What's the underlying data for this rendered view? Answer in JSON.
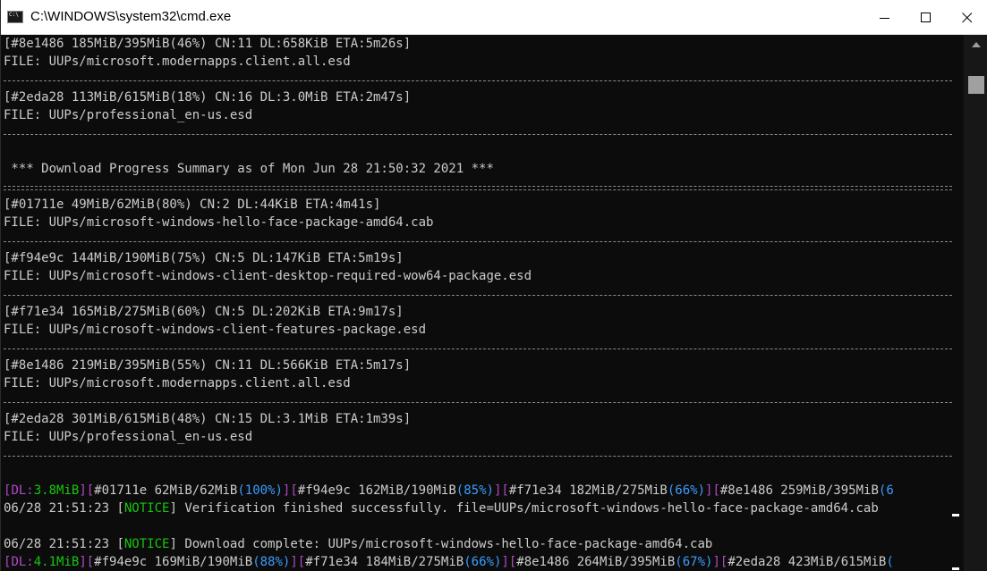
{
  "window": {
    "title": "C:\\WINDOWS\\system32\\cmd.exe",
    "icon_label": "C:\\",
    "icon": "cmd-app-icon",
    "controls": [
      "minimize-icon",
      "maximize-icon",
      "close-icon"
    ]
  },
  "console": {
    "lines": [
      "[#8e1486 185MiB/395MiB(46%) CN:11 DL:658KiB ETA:5m26s]",
      "FILE: UUPs/microsoft.modernapps.client.all.esd",
      "[#2eda28 113MiB/615MiB(18%) CN:16 DL:3.0MiB ETA:2m47s]",
      "FILE: UUPs/professional_en-us.esd",
      " *** Download Progress Summary as of Mon Jun 28 21:50:32 2021 ***",
      "[#01711e 49MiB/62MiB(80%) CN:2 DL:44KiB ETA:4m41s]",
      "FILE: UUPs/microsoft-windows-hello-face-package-amd64.cab",
      "[#f94e9c 144MiB/190MiB(75%) CN:5 DL:147KiB ETA:5m19s]",
      "FILE: UUPs/microsoft-windows-client-desktop-required-wow64-package.esd",
      "[#f71e34 165MiB/275MiB(60%) CN:5 DL:202KiB ETA:9m17s]",
      "FILE: UUPs/microsoft-windows-client-features-package.esd",
      "[#8e1486 219MiB/395MiB(55%) CN:11 DL:566KiB ETA:5m17s]",
      "FILE: UUPs/microsoft.modernapps.client.all.esd",
      "[#2eda28 301MiB/615MiB(48%) CN:15 DL:3.1MiB ETA:1m39s]",
      "FILE: UUPs/professional_en-us.esd"
    ],
    "status1": [
      {
        "text": "[",
        "c": "p"
      },
      {
        "text": "DL:",
        "c": "p"
      },
      {
        "text": "3.8MiB",
        "c": "g"
      },
      {
        "text": "][",
        "c": "p"
      },
      {
        "text": "#01711e 62MiB/62MiB",
        "c": "t"
      },
      {
        "text": "(",
        "c": "b"
      },
      {
        "text": "100%",
        "c": "b"
      },
      {
        "text": ")",
        "c": "b"
      },
      {
        "text": "][",
        "c": "p"
      },
      {
        "text": "#f94e9c 162MiB/190MiB",
        "c": "t"
      },
      {
        "text": "(",
        "c": "b"
      },
      {
        "text": "85%",
        "c": "b"
      },
      {
        "text": ")",
        "c": "b"
      },
      {
        "text": "][",
        "c": "p"
      },
      {
        "text": "#f71e34 182MiB/275MiB",
        "c": "t"
      },
      {
        "text": "(",
        "c": "b"
      },
      {
        "text": "66%",
        "c": "b"
      },
      {
        "text": ")",
        "c": "b"
      },
      {
        "text": "][",
        "c": "p"
      },
      {
        "text": "#8e1486 259MiB/395MiB",
        "c": "t"
      },
      {
        "text": "(6",
        "c": "b"
      }
    ],
    "notice1": {
      "time": "06/28 21:51:23 ",
      "tag": "NOTICE",
      "message": " Verification finished successfully. file=UUPs/microsoft-windows-hello-face-package-amd64.cab"
    },
    "notice2": {
      "time": "06/28 21:51:23 ",
      "tag": "NOTICE",
      "message": " Download complete: UUPs/microsoft-windows-hello-face-package-amd64.cab"
    },
    "status2": [
      {
        "text": "[",
        "c": "p"
      },
      {
        "text": "DL:",
        "c": "p"
      },
      {
        "text": "4.1MiB",
        "c": "g"
      },
      {
        "text": "][",
        "c": "p"
      },
      {
        "text": "#f94e9c 169MiB/190MiB",
        "c": "t"
      },
      {
        "text": "(",
        "c": "b"
      },
      {
        "text": "88%",
        "c": "b"
      },
      {
        "text": ")",
        "c": "b"
      },
      {
        "text": "][",
        "c": "p"
      },
      {
        "text": "#f71e34 184MiB/275MiB",
        "c": "t"
      },
      {
        "text": "(",
        "c": "b"
      },
      {
        "text": "66%",
        "c": "b"
      },
      {
        "text": ")",
        "c": "b"
      },
      {
        "text": "][",
        "c": "p"
      },
      {
        "text": "#8e1486 264MiB/395MiB",
        "c": "t"
      },
      {
        "text": "(",
        "c": "b"
      },
      {
        "text": "67%",
        "c": "b"
      },
      {
        "text": ")",
        "c": "b"
      },
      {
        "text": "][",
        "c": "p"
      },
      {
        "text": "#2eda28 423MiB/615MiB",
        "c": "t"
      },
      {
        "text": "(",
        "c": "b"
      }
    ]
  },
  "colors": {
    "background": "#0c0c0c",
    "text": "#cccccc",
    "bracket": "#b148c6",
    "speed": "#16c60c",
    "percent": "#3b9dff",
    "notice": "#16c60c"
  }
}
